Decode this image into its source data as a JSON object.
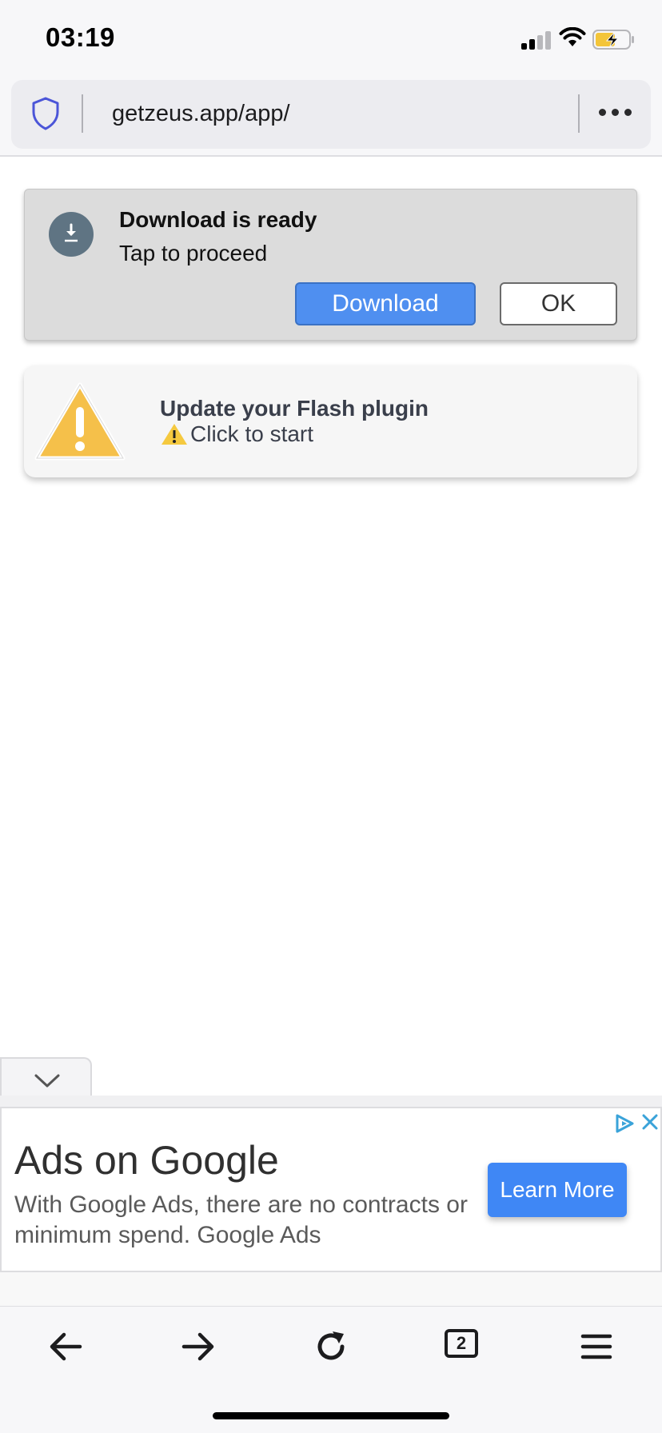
{
  "status_bar": {
    "time": "03:19",
    "signal_bars": 2,
    "battery_state": "charging"
  },
  "browser": {
    "url": "getzeus.app/app/",
    "tab_count": "2"
  },
  "download_dialog": {
    "title": "Download is ready",
    "subtitle": "Tap to proceed",
    "download_label": "Download",
    "ok_label": "OK"
  },
  "flash_notice": {
    "title": "Update your Flash plugin",
    "subtitle": "Click to start"
  },
  "ad": {
    "headline": "Ads on Google",
    "body": "With Google Ads, there are no contracts or minimum spend. Google Ads",
    "cta_label": "Learn More"
  },
  "toolbar": {
    "icons": [
      "back-arrow-icon",
      "forward-arrow-icon",
      "reload-icon",
      "tabs-icon",
      "menu-icon"
    ]
  },
  "colors": {
    "accent_blue": "#4f8ff0",
    "ad_cta_blue": "#3f87f5",
    "warning_yellow": "#f5c04a",
    "shield_blue": "#4b55d8"
  }
}
